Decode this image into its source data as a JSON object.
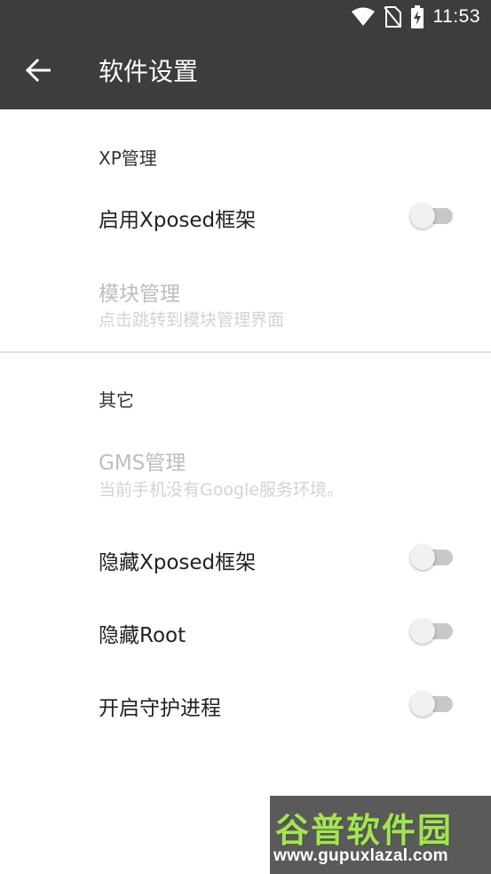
{
  "status_bar": {
    "time": "11:53",
    "icons": [
      "wifi-icon",
      "no-sim-icon",
      "battery-charging-icon"
    ]
  },
  "app_bar": {
    "back_icon": "arrow-back-icon",
    "title": "软件设置"
  },
  "sections": [
    {
      "header": "XP管理",
      "items": [
        {
          "title": "启用Xposed框架",
          "type": "switch",
          "checked": false,
          "enabled": true
        },
        {
          "title": "模块管理",
          "subtitle": "点击跳转到模块管理界面",
          "enabled": false
        }
      ]
    },
    {
      "header": "其它",
      "items": [
        {
          "title": "GMS管理",
          "subtitle": "当前手机没有Google服务环境。",
          "enabled": false
        },
        {
          "title": "隐藏Xposed框架",
          "type": "switch",
          "checked": false,
          "enabled": true
        },
        {
          "title": "隐藏Root",
          "type": "switch",
          "checked": false,
          "enabled": true
        },
        {
          "title": "开启守护进程",
          "type": "switch",
          "checked": false,
          "enabled": true
        }
      ]
    }
  ],
  "watermark": {
    "text": "谷普软件园",
    "url": "www.gupuxlazal.com"
  },
  "colors": {
    "app_bar": "#3d3d3d",
    "disabled_text": "#bdbdbd",
    "switch_track_off": "#c8c8c8",
    "switch_thumb_off": "#f1f1f1"
  }
}
